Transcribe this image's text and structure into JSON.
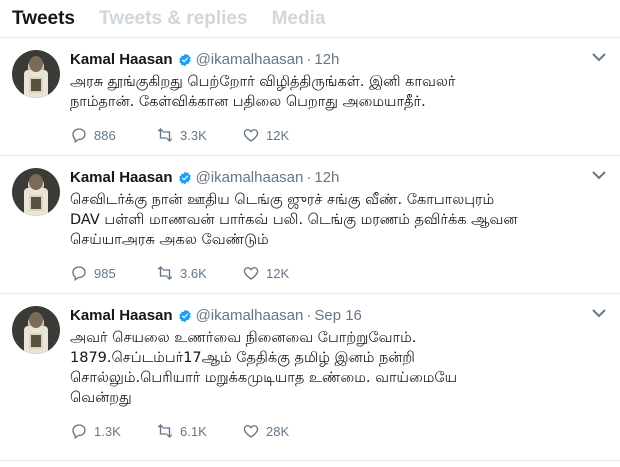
{
  "tabs": [
    {
      "label": "Tweets",
      "active": true
    },
    {
      "label": "Tweets & replies",
      "active": false
    },
    {
      "label": "Media",
      "active": false
    }
  ],
  "colors": {
    "accent": "#1da1f2",
    "muted": "#657786",
    "text": "#14171a",
    "inactive_tab": "#cfd6dc"
  },
  "tweets": [
    {
      "name": "Kamal Haasan",
      "handle": "@ikamalhaasan",
      "time": "12h",
      "text": "அரசு தூங்குகிறது பெற்றோர் விழித்திருங்கள். இனி காவலர்\nநாம்தான். கேள்விக்கான பதிலை பெறாது அமையாதீர்.",
      "replies": "886",
      "retweets": "3.3K",
      "likes": "12K"
    },
    {
      "name": "Kamal Haasan",
      "handle": "@ikamalhaasan",
      "time": "12h",
      "text": "செவிடர்க்கு நான் ஊதிய டெங்கு ஜுரச் சங்கு வீண். கோபாலபுரம்\nDAV பள்ளி மாணவன் பார்கவ் பலி. டெங்கு மரணம் தவிர்க்க ஆவன\nசெய்யாஅரசு அகல வேண்டும்",
      "replies": "985",
      "retweets": "3.6K",
      "likes": "12K"
    },
    {
      "name": "Kamal Haasan",
      "handle": "@ikamalhaasan",
      "time": "Sep 16",
      "text": "அவர் செயலை உணர்வை நினைவை போற்றுவோம்.\n1879.செப்டம்பர்17ஆம் தேதிக்கு தமிழ் இனம் நன்றி\nசொல்லும்.பெரியார் மறுக்கமுடியாத உண்மை. வாய்மையே\nவென்றது",
      "replies": "1.3K",
      "retweets": "6.1K",
      "likes": "28K"
    }
  ],
  "icons": {
    "verified": "verified-badge-icon",
    "reply": "reply-icon",
    "retweet": "retweet-icon",
    "like": "heart-icon",
    "more": "chevron-down-icon"
  }
}
